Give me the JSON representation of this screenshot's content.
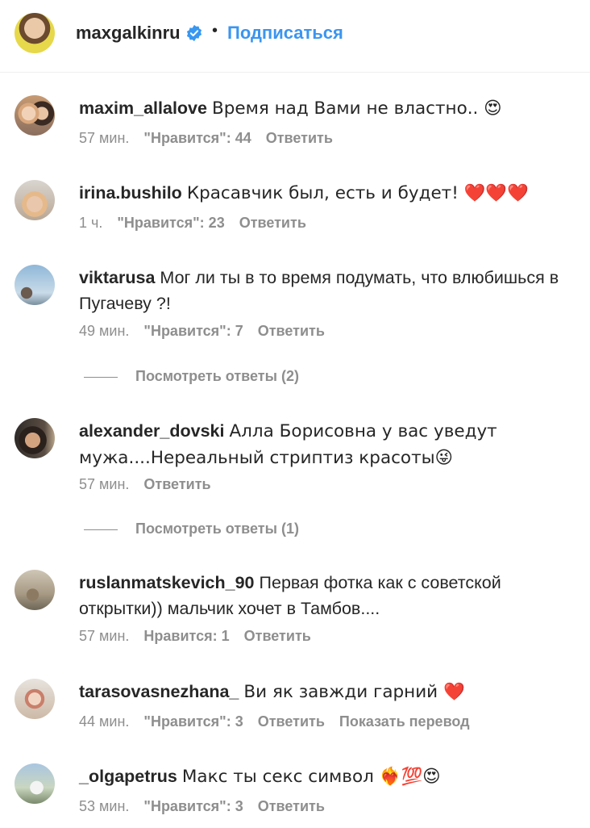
{
  "header": {
    "username": "maxgalkinru",
    "separator": "•",
    "follow_label": "Подписаться"
  },
  "comments": [
    {
      "user": "maxim_allalove",
      "text": "Время над Вами не властно.. 😍",
      "time": "57 мин.",
      "likes": "\"Нравится\": 44",
      "reply": "Ответить"
    },
    {
      "user": "irina.bushilo",
      "text": "Красавчик был, есть и будет! ❤️❤️❤️",
      "time": "1 ч.",
      "likes": "\"Нравится\": 23",
      "reply": "Ответить"
    },
    {
      "user": "viktarusa",
      "text": "Мог ли ты в то время подумать, что влюбишься в Пугачеву ?!",
      "time": "49 мин.",
      "likes": "\"Нравится\": 7",
      "reply": "Ответить",
      "view_replies": "Посмотреть ответы (2)"
    },
    {
      "user": "alexander_dovski",
      "text": "Алла Борисовна у вас уведут мужа....Нереальный стриптиз красоты😜",
      "time": "57 мин.",
      "reply": "Ответить",
      "view_replies": "Посмотреть ответы (1)"
    },
    {
      "user": "ruslanmatskevich_90",
      "text": "Первая фотка как с советской открытки)) мальчик хочет в Тамбов....",
      "time": "57 мин.",
      "likes": "Нравится: 1",
      "reply": "Ответить"
    },
    {
      "user": "tarasovasnezhana_",
      "text": "Ви як завжди гарний ❤️",
      "time": "44 мин.",
      "likes": "\"Нравится\": 3",
      "reply": "Ответить",
      "translate": "Показать перевод"
    },
    {
      "user": "_olgapetrus",
      "text": "Макс ты секс символ ❤️‍🔥💯😍",
      "time": "53 мин.",
      "likes": "\"Нравится\": 3",
      "reply": "Ответить"
    }
  ],
  "colors": {
    "link": "#3b95f0",
    "meta": "#8e8e8e",
    "text": "#262626",
    "verified": "#3897f0"
  }
}
